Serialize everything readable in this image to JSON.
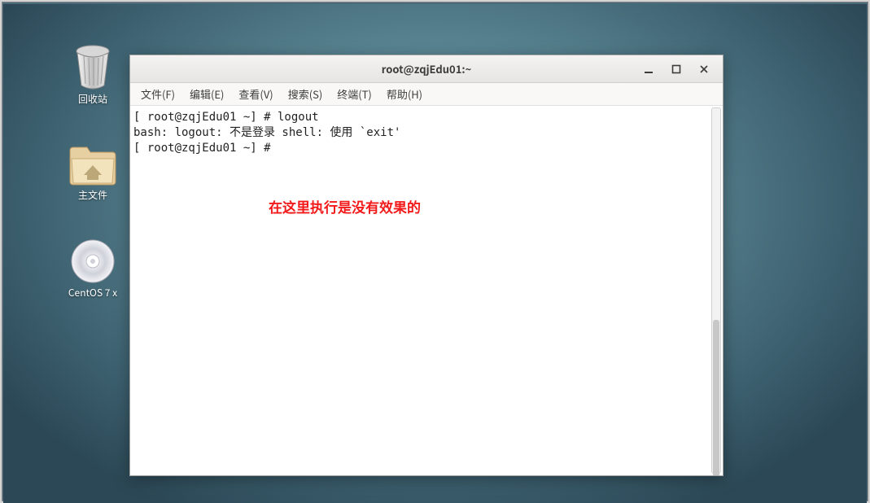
{
  "desktop": {
    "icons": [
      {
        "name": "trash",
        "label": "回收站"
      },
      {
        "name": "home-folder",
        "label": "主文件"
      },
      {
        "name": "centos-cd",
        "label": "CentOS 7 x"
      }
    ]
  },
  "terminal": {
    "title": "root@zqjEdu01:~",
    "menu": [
      {
        "label": "文件(F)"
      },
      {
        "label": "编辑(E)"
      },
      {
        "label": "查看(V)"
      },
      {
        "label": "搜索(S)"
      },
      {
        "label": "终端(T)"
      },
      {
        "label": "帮助(H)"
      }
    ],
    "lines": {
      "l1": "[ root@zqjEdu01 ~] # logout",
      "l2": "bash: logout: 不是登录 shell: 使用 `exit'",
      "l3": "[ root@zqjEdu01 ~] # "
    },
    "annotation": "在这里执行是没有效果的"
  }
}
